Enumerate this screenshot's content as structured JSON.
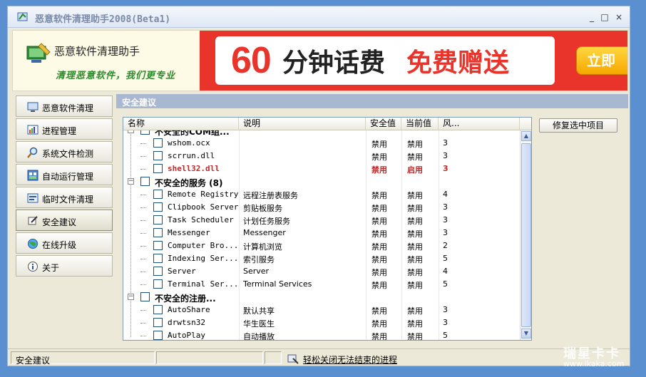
{
  "window": {
    "title": "恶意软件清理助手2008(Beta1)",
    "controls": [
      "_",
      "□",
      "×"
    ]
  },
  "banner": {
    "title": "恶意软件清理助手",
    "slogan": "清理恶意软件，我们更专业",
    "ad": {
      "number": "60",
      "text1": "分钟话费",
      "text2": "免费赠送",
      "cta": "立即"
    }
  },
  "nav": {
    "items": [
      {
        "label": "恶意软件清理",
        "icon": "monitor-icon"
      },
      {
        "label": "进程管理",
        "icon": "process-icon"
      },
      {
        "label": "系统文件检测",
        "icon": "magnifier-icon"
      },
      {
        "label": "自动运行管理",
        "icon": "startup-icon"
      },
      {
        "label": "临时文件清理",
        "icon": "temp-files-icon"
      },
      {
        "label": "安全建议",
        "icon": "security-tip-icon"
      },
      {
        "label": "在线升级",
        "icon": "globe-icon"
      },
      {
        "label": "关于",
        "icon": "info-icon"
      }
    ],
    "active_index": 5
  },
  "panel": {
    "header": "安全建议",
    "columns": [
      "名称",
      "说明",
      "安全值",
      "当前值",
      "风..."
    ],
    "fix_button": "修复选中项目",
    "rows": [
      {
        "kind": "group-partial",
        "name": "不安全的COM组..."
      },
      {
        "kind": "item",
        "name": "wshom.ocx",
        "desc": "",
        "safe": "禁用",
        "current": "禁用",
        "risk": "3"
      },
      {
        "kind": "item",
        "name": "scrrun.dll",
        "desc": "",
        "safe": "禁用",
        "current": "禁用",
        "risk": "3"
      },
      {
        "kind": "item",
        "name": "shell32.dll",
        "desc": "",
        "safe": "禁用",
        "current": "启用",
        "risk": "3",
        "danger": true
      },
      {
        "kind": "group",
        "name": "不安全的服务 (8)"
      },
      {
        "kind": "item",
        "name": "Remote Registry",
        "desc": "远程注册表服务",
        "safe": "禁用",
        "current": "禁用",
        "risk": "4"
      },
      {
        "kind": "item",
        "name": "Clipbook Server",
        "desc": "剪贴板服务",
        "safe": "禁用",
        "current": "禁用",
        "risk": "3"
      },
      {
        "kind": "item",
        "name": "Task Scheduler",
        "desc": "计划任务服务",
        "safe": "禁用",
        "current": "禁用",
        "risk": "3"
      },
      {
        "kind": "item",
        "name": "Messenger",
        "desc": "Messenger",
        "safe": "禁用",
        "current": "禁用",
        "risk": "3"
      },
      {
        "kind": "item",
        "name": "Computer Bro...",
        "desc": "计算机浏览",
        "safe": "禁用",
        "current": "禁用",
        "risk": "2"
      },
      {
        "kind": "item",
        "name": "Indexing Ser...",
        "desc": "索引服务",
        "safe": "禁用",
        "current": "禁用",
        "risk": "5"
      },
      {
        "kind": "item",
        "name": "Server",
        "desc": "Server",
        "safe": "禁用",
        "current": "禁用",
        "risk": "4"
      },
      {
        "kind": "item",
        "name": "Terminal Ser...",
        "desc": "Terminal Services",
        "safe": "禁用",
        "current": "禁用",
        "risk": "5"
      },
      {
        "kind": "group",
        "name": "不安全的注册..."
      },
      {
        "kind": "item",
        "name": "AutoShare",
        "desc": "默认共享",
        "safe": "禁用",
        "current": "禁用",
        "risk": "3"
      },
      {
        "kind": "item",
        "name": "drwtsn32",
        "desc": "华生医生",
        "safe": "禁用",
        "current": "禁用",
        "risk": "3"
      },
      {
        "kind": "item",
        "name": "AutoPlay",
        "desc": "自动播放",
        "safe": "禁用",
        "current": "禁用",
        "risk": "5"
      }
    ]
  },
  "statusbar": {
    "text": "安全建议",
    "link": "轻松关闭无法结束的进程"
  },
  "watermark": {
    "line1": "瑞星卡卡",
    "line2": "www.ikaka.com"
  }
}
